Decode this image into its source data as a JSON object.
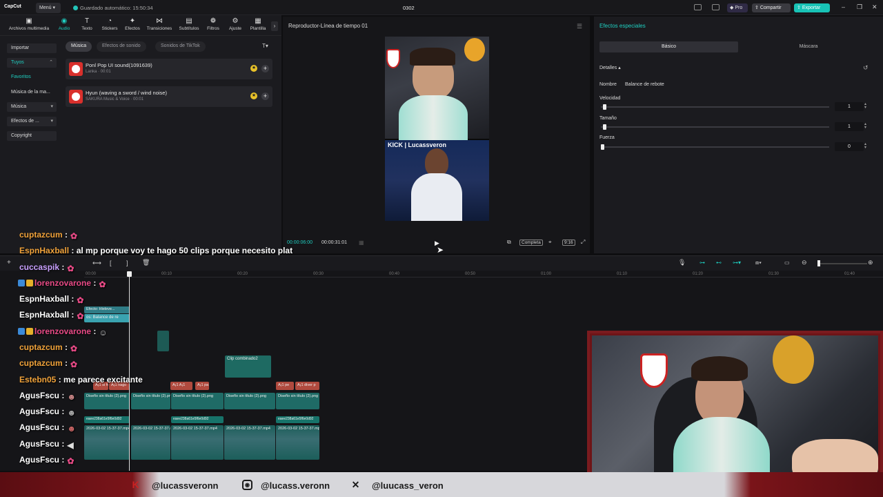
{
  "titlebar": {
    "app_name": "CapCut",
    "menu_label": "Menú",
    "autosave": "Guardado automático: 15:50:34",
    "project_name": "0302",
    "pro_label": "Pro",
    "share_label": "Compartir",
    "export_label": "Exportar"
  },
  "toolbar": {
    "tools": [
      "Archivos multimedia",
      "Audio",
      "Texto",
      "Stickers",
      "Efectos",
      "Transiciones",
      "Subtítulos",
      "Filtros",
      "Ajuste",
      "Plantilla"
    ],
    "active_tool": "Audio"
  },
  "sidenav": {
    "items": [
      "Importar",
      "Tuyos",
      "Favoritos",
      "Música de la ma...",
      "Música",
      "Efectos de ...",
      "Copyright"
    ]
  },
  "audio": {
    "pills": [
      "Música",
      "Efectos de sonido",
      "Sonidos de TikTok"
    ],
    "tracks": [
      {
        "title": "Ponl Pop UI sound(1091639)",
        "subtitle": "Lanka · 00:01"
      },
      {
        "title": "Hyun (waving a sword / wind noise)",
        "subtitle": "SAKURA Music & Voice · 00:01"
      }
    ]
  },
  "player": {
    "title": "Reproductor-Línea de tiempo 01",
    "current_time": "00:00:06:00",
    "total_time": "00:00:31:01",
    "complete_label": "Completa",
    "ratio_label": "9:16",
    "overlay_text": "KICK | Lucassveron"
  },
  "effects": {
    "title": "Efectos especiales",
    "tab_basic": "Básico",
    "tab_mask": "Máscara",
    "details_label": "Detalles",
    "name_label": "Nombre",
    "name_value": "Balance de rebote",
    "params": [
      {
        "label": "Velocidad",
        "value": "1",
        "level": 0.01
      },
      {
        "label": "Tamaño",
        "value": "1",
        "level": 0.01
      },
      {
        "label": "Fuerza",
        "value": "0",
        "level": 0
      }
    ]
  },
  "timeline": {
    "ruler": [
      "00:00",
      "00:10",
      "00:20",
      "00:30",
      "00:40",
      "00:50",
      "01:00",
      "01:10",
      "01:20",
      "01:30",
      "01:40"
    ],
    "clips": {
      "effect": "Efecto: Hieleve...",
      "effect2": "os: Balance de re",
      "combined": "Clip combinado2",
      "design": "Diseño sin título (2).png",
      "text_a": "A¡1 si ho",
      "text_b": "A¡1 hago",
      "text_c": "A¡1 A¡1",
      "text_d": "A¡1 pa",
      "text_e": "A¡1 pe",
      "text_f": "A¡1 diver p",
      "hash": "eaee238a61e5f6e0d92",
      "video": "2026-03-02 15-37-37.mp4"
    }
  },
  "chat": [
    {
      "user": "cuptazcum",
      "msg": ":",
      "color": "orange"
    },
    {
      "user": "EspnHaxball",
      "msg": ": al mp porque voy te hago 50 clips porque necesito plat",
      "color": "orange"
    },
    {
      "user": "cuccaspik",
      "msg": ":",
      "color": "purple"
    },
    {
      "user": "lorenzovarone",
      "msg": ":",
      "color": "pink"
    },
    {
      "user": "EspnHaxball",
      "msg": ":",
      "color": "white"
    },
    {
      "user": "EspnHaxball",
      "msg": ":",
      "color": "white"
    },
    {
      "user": "lorenzovarone",
      "msg": ":",
      "color": "pink"
    },
    {
      "user": "cuptazcum",
      "msg": ":",
      "color": "orange"
    },
    {
      "user": "cuptazcum",
      "msg": ":",
      "color": "orange"
    },
    {
      "user": "Estebn05",
      "msg": ": me parece excitante",
      "color": "orange"
    },
    {
      "user": "AgusFscu",
      "msg": ":",
      "color": "white"
    },
    {
      "user": "AgusFscu",
      "msg": ":",
      "color": "white"
    },
    {
      "user": "AgusFscu",
      "msg": ":",
      "color": "white"
    },
    {
      "user": "AgusFscu",
      "msg": ":",
      "color": "white"
    },
    {
      "user": "AgusFscu",
      "msg": ":",
      "color": "white"
    }
  ],
  "banner": {
    "kick": "@lucassveronn",
    "instagram": "@lucass.veronn",
    "x": "@luucass_veron"
  },
  "colors": {
    "accent": "#1fd0c2",
    "banner_red": "#7a1419"
  }
}
